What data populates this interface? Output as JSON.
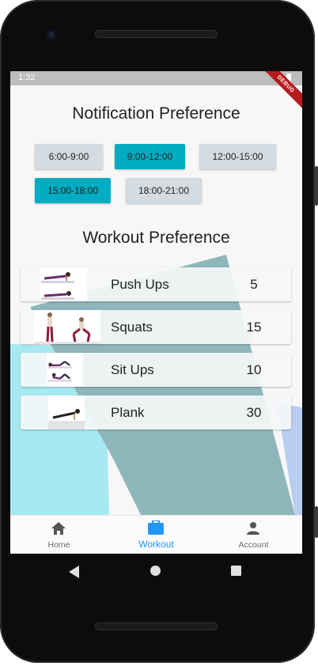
{
  "status": {
    "time": "1:32",
    "debug_label": "DEBUG"
  },
  "notification": {
    "title": "Notification Preference",
    "slots": [
      {
        "label": "6:00-9:00",
        "selected": false
      },
      {
        "label": "9:00-12:00",
        "selected": true
      },
      {
        "label": "12:00-15:00",
        "selected": false
      },
      {
        "label": "15:00-18:00",
        "selected": true
      },
      {
        "label": "18:00-21:00",
        "selected": false
      }
    ]
  },
  "workout": {
    "title": "Workout Preference",
    "items": [
      {
        "name": "Push Ups",
        "count": "5",
        "icon": "push-ups-illustration"
      },
      {
        "name": "Squats",
        "count": "15",
        "icon": "squats-illustration"
      },
      {
        "name": "Sit Ups",
        "count": "10",
        "icon": "sit-ups-illustration"
      },
      {
        "name": "Plank",
        "count": "30",
        "icon": "plank-illustration"
      }
    ]
  },
  "bottom_nav": {
    "items": [
      {
        "label": "Home",
        "icon": "home-icon",
        "active": false
      },
      {
        "label": "Workout",
        "icon": "briefcase-icon",
        "active": true
      },
      {
        "label": "Account",
        "icon": "person-icon",
        "active": false
      }
    ]
  },
  "colors": {
    "accent": "#00acc1",
    "chip_off": "#d4dbe1",
    "nav_active": "#2196f3",
    "bg_teal": "#8fb7bb",
    "bg_cyan": "#a7e9f1",
    "bg_blue": "#b9cdf3"
  }
}
